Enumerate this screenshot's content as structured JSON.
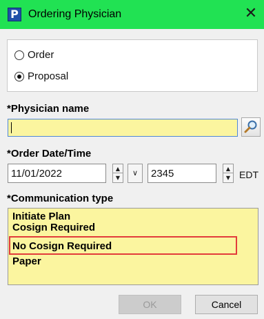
{
  "window": {
    "title": "Ordering Physician",
    "app_icon_letter": "P",
    "close_glyph": "✕"
  },
  "mode": {
    "options": [
      {
        "label": "Order",
        "selected": false
      },
      {
        "label": "Proposal",
        "selected": true
      }
    ]
  },
  "physician": {
    "label": "*Physician name",
    "value": "",
    "lookup_icon": "magnifier-icon"
  },
  "order_datetime": {
    "label": "*Order Date/Time",
    "date": "11/01/2022",
    "time": "2345",
    "timezone": "EDT"
  },
  "communication": {
    "label": "*Communication type",
    "items": [
      "Initiate Plan",
      "Cosign Required",
      "No Cosign Required",
      "Paper"
    ],
    "highlighted": "No Cosign Required"
  },
  "buttons": {
    "ok": "OK",
    "cancel": "Cancel"
  },
  "colors": {
    "titlebar": "#21e253",
    "required_field": "#fbf59f",
    "highlight_box": "#e23b3b"
  }
}
